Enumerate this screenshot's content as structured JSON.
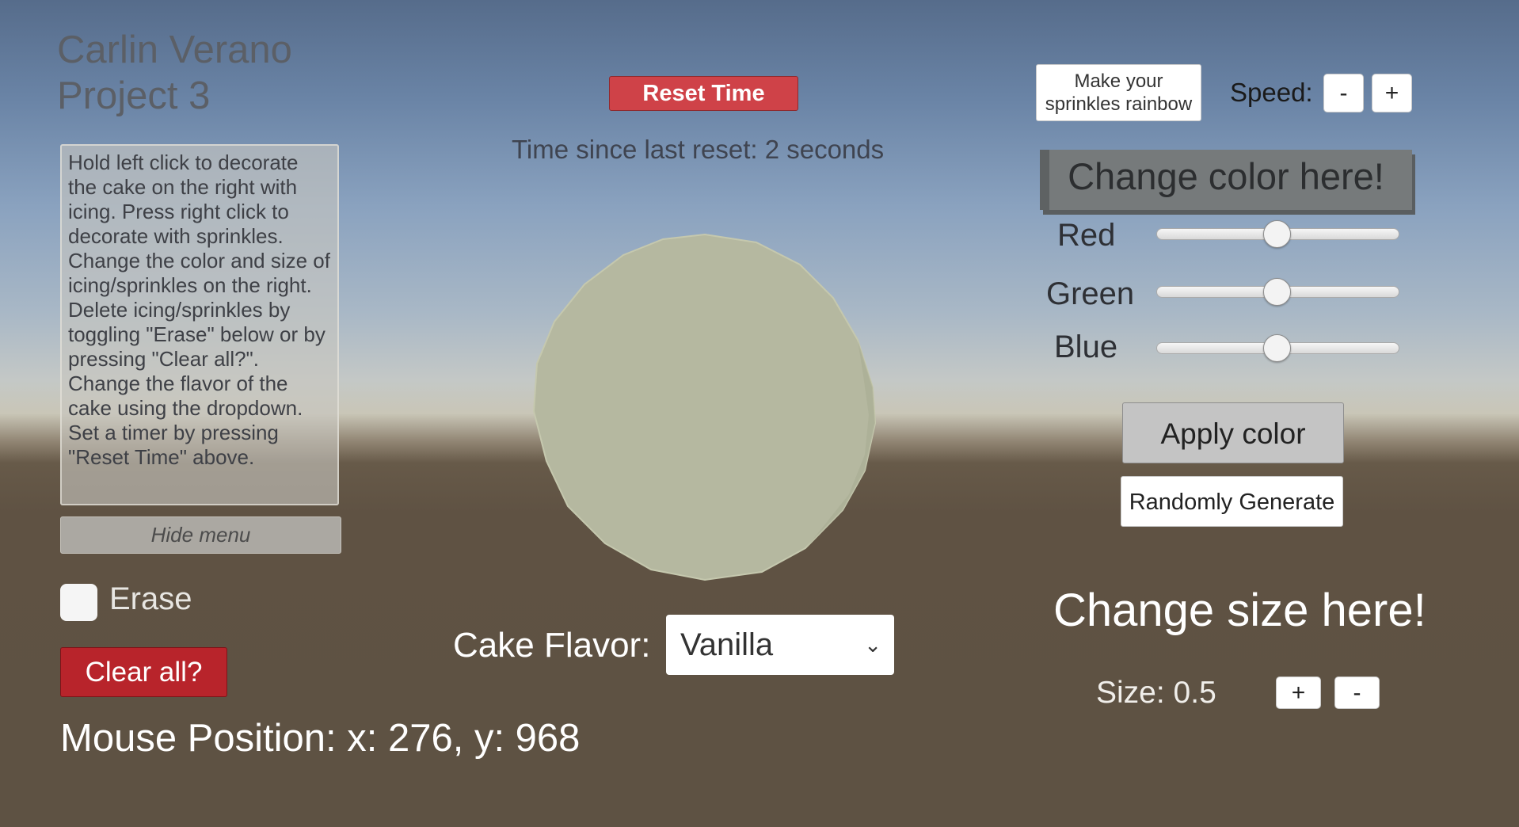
{
  "title": {
    "line1": "Carlin Verano",
    "line2": "Project 3"
  },
  "instructions": "Hold left click to decorate the cake on the right with icing. Press right click to decorate with sprinkles.\nChange the color and size of icing/sprinkles on the right.\nDelete icing/sprinkles by toggling \"Erase\" below or by pressing \"Clear all?\".\nChange the flavor of the cake using the dropdown.\nSet a timer by pressing \"Reset Time\" above.",
  "hide_menu_label": "Hide menu",
  "erase": {
    "label": "Erase",
    "checked": false
  },
  "clear_all_label": "Clear all?",
  "mouse_position": "Mouse Position: x: 276, y: 968",
  "timer": {
    "reset_label": "Reset Time",
    "status": "Time since last reset: 2 seconds"
  },
  "cake": {
    "color": "#b5b8a0",
    "shape": "polygon-circle"
  },
  "flavor": {
    "label": "Cake Flavor:",
    "selected": "Vanilla",
    "chevron_icon": "chevron-down-icon"
  },
  "rainbow_label": "Make your sprinkles rainbow",
  "speed": {
    "label": "Speed:",
    "minus_label": "-",
    "plus_label": "+"
  },
  "color_panel": {
    "header": "Change color here!",
    "sliders": [
      {
        "label": "Red",
        "value": 0.5
      },
      {
        "label": "Green",
        "value": 0.5
      },
      {
        "label": "Blue",
        "value": 0.5
      }
    ],
    "apply_label": "Apply color",
    "random_label": "Randomly Generate"
  },
  "size_panel": {
    "header": "Change size here!",
    "size_text": "Size: 0.5",
    "plus_label": "+",
    "minus_label": "-"
  },
  "colors": {
    "reset_button": "#cf4248",
    "clear_button": "#b8242b",
    "ground": "#5e5243"
  }
}
